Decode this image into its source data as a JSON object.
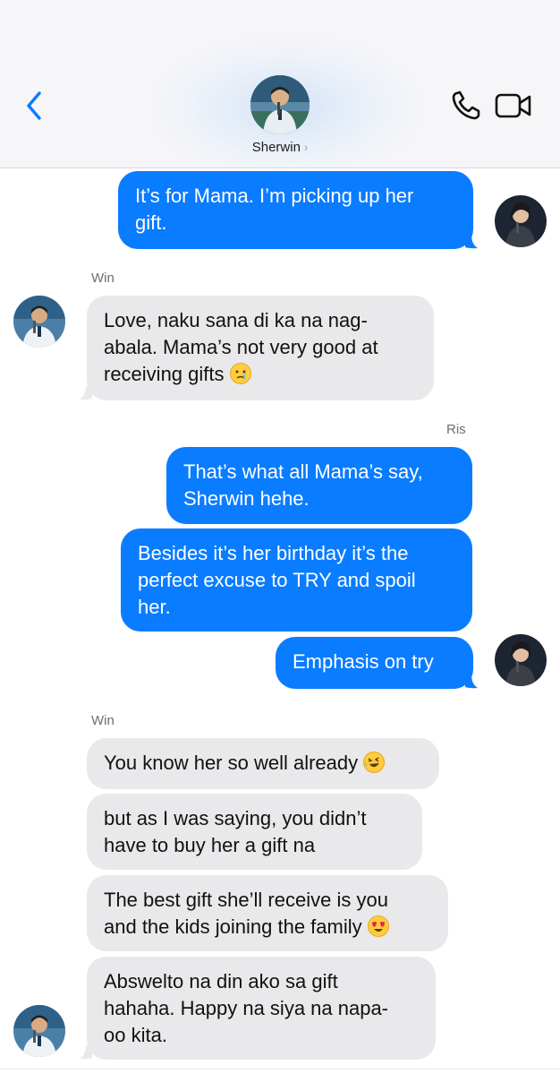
{
  "header": {
    "contact_name": "Sherwin",
    "chevron": "›",
    "icons": {
      "back": "chevron-left-icon",
      "call": "phone-icon",
      "video": "video-camera-icon"
    },
    "accent_color": "#0a7cff"
  },
  "messages": {
    "m1": "It’s for Mama. I’m picking up her gift.",
    "m1_line1": "It’s for Mama. I’m picking up her",
    "m1_line2": "gift.",
    "label_win_1": "Win",
    "m2_line1": "Love, naku sana di ka na nag-",
    "m2_line2": "abala. Mama’s not very good at",
    "m2_line3": "receiving gifts",
    "m2_emoji": "crying-face-emoji",
    "label_ris": "Ris",
    "m3_line1": "That’s what all Mama’s say,",
    "m3_line2": "Sherwin hehe.",
    "m4_line1": "Besides it’s her birthday it’s the",
    "m4_line2": "perfect excuse to TRY and spoil",
    "m4_line3": "her.",
    "m5": "Emphasis on try",
    "label_win_2": "Win",
    "m6": "You know her so well already",
    "m6_emoji": "rolling-laughing-emoji",
    "m7_line1": "but as I was saying, you didn’t",
    "m7_line2": "have to buy her a gift na",
    "m8_line1": "The best gift she’ll receive is you",
    "m8_line2": "and the kids joining the family",
    "m8_emoji": "heart-eyes-emoji",
    "m9_line1": "Abswelto na din ako sa gift",
    "m9_line2": "hahaha. Happy na siya na napa-",
    "m9_line3": "oo kita."
  },
  "colors": {
    "outgoing_bubble": "#0a7cff",
    "incoming_bubble": "#e9e9eb",
    "header_bg": "#f6f6f8"
  }
}
